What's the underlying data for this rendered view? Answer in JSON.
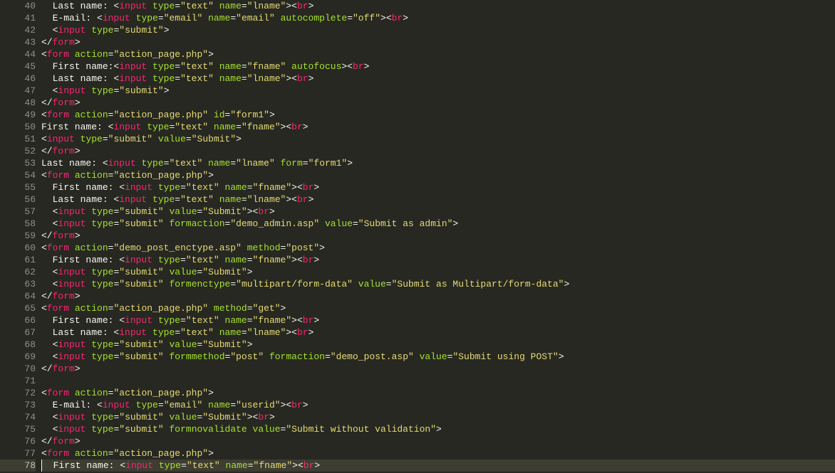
{
  "first_line_number": 40,
  "current_line_number": 78,
  "lines": [
    [
      [
        "plain",
        "  Last name: <"
      ],
      [
        "tag",
        "input"
      ],
      [
        "plain",
        " "
      ],
      [
        "attr",
        "type"
      ],
      [
        "op",
        "="
      ],
      [
        "str",
        "\"text\""
      ],
      [
        "plain",
        " "
      ],
      [
        "attr",
        "name"
      ],
      [
        "op",
        "="
      ],
      [
        "str",
        "\"lname\""
      ],
      [
        "plain",
        "><"
      ],
      [
        "tag",
        "br"
      ],
      [
        "plain",
        ">"
      ]
    ],
    [
      [
        "plain",
        "  E-mail: <"
      ],
      [
        "tag",
        "input"
      ],
      [
        "plain",
        " "
      ],
      [
        "attr",
        "type"
      ],
      [
        "op",
        "="
      ],
      [
        "str",
        "\"email\""
      ],
      [
        "plain",
        " "
      ],
      [
        "attr",
        "name"
      ],
      [
        "op",
        "="
      ],
      [
        "str",
        "\"email\""
      ],
      [
        "plain",
        " "
      ],
      [
        "attr",
        "autocomplete"
      ],
      [
        "op",
        "="
      ],
      [
        "str",
        "\"off\""
      ],
      [
        "plain",
        "><"
      ],
      [
        "tag",
        "br"
      ],
      [
        "plain",
        ">"
      ]
    ],
    [
      [
        "plain",
        "  <"
      ],
      [
        "tag",
        "input"
      ],
      [
        "plain",
        " "
      ],
      [
        "attr",
        "type"
      ],
      [
        "op",
        "="
      ],
      [
        "str",
        "\"submit\""
      ],
      [
        "plain",
        ">"
      ]
    ],
    [
      [
        "plain",
        "</"
      ],
      [
        "tag",
        "form"
      ],
      [
        "plain",
        ">"
      ]
    ],
    [
      [
        "plain",
        "<"
      ],
      [
        "tag",
        "form"
      ],
      [
        "plain",
        " "
      ],
      [
        "attr",
        "action"
      ],
      [
        "op",
        "="
      ],
      [
        "str",
        "\"action_page.php\""
      ],
      [
        "plain",
        ">"
      ]
    ],
    [
      [
        "plain",
        "  First name:<"
      ],
      [
        "tag",
        "input"
      ],
      [
        "plain",
        " "
      ],
      [
        "attr",
        "type"
      ],
      [
        "op",
        "="
      ],
      [
        "str",
        "\"text\""
      ],
      [
        "plain",
        " "
      ],
      [
        "attr",
        "name"
      ],
      [
        "op",
        "="
      ],
      [
        "str",
        "\"fname\""
      ],
      [
        "plain",
        " "
      ],
      [
        "boolattr",
        "autofocus"
      ],
      [
        "plain",
        "><"
      ],
      [
        "tag",
        "br"
      ],
      [
        "plain",
        ">"
      ]
    ],
    [
      [
        "plain",
        "  Last name: <"
      ],
      [
        "tag",
        "input"
      ],
      [
        "plain",
        " "
      ],
      [
        "attr",
        "type"
      ],
      [
        "op",
        "="
      ],
      [
        "str",
        "\"text\""
      ],
      [
        "plain",
        " "
      ],
      [
        "attr",
        "name"
      ],
      [
        "op",
        "="
      ],
      [
        "str",
        "\"lname\""
      ],
      [
        "plain",
        "><"
      ],
      [
        "tag",
        "br"
      ],
      [
        "plain",
        ">"
      ]
    ],
    [
      [
        "plain",
        "  <"
      ],
      [
        "tag",
        "input"
      ],
      [
        "plain",
        " "
      ],
      [
        "attr",
        "type"
      ],
      [
        "op",
        "="
      ],
      [
        "str",
        "\"submit\""
      ],
      [
        "plain",
        ">"
      ]
    ],
    [
      [
        "plain",
        "</"
      ],
      [
        "tag",
        "form"
      ],
      [
        "plain",
        ">"
      ]
    ],
    [
      [
        "plain",
        "<"
      ],
      [
        "tag",
        "form"
      ],
      [
        "plain",
        " "
      ],
      [
        "attr",
        "action"
      ],
      [
        "op",
        "="
      ],
      [
        "str",
        "\"action_page.php\""
      ],
      [
        "plain",
        " "
      ],
      [
        "attr",
        "id"
      ],
      [
        "op",
        "="
      ],
      [
        "str",
        "\"form1\""
      ],
      [
        "plain",
        ">"
      ]
    ],
    [
      [
        "plain",
        "First name: <"
      ],
      [
        "tag",
        "input"
      ],
      [
        "plain",
        " "
      ],
      [
        "attr",
        "type"
      ],
      [
        "op",
        "="
      ],
      [
        "str",
        "\"text\""
      ],
      [
        "plain",
        " "
      ],
      [
        "attr",
        "name"
      ],
      [
        "op",
        "="
      ],
      [
        "str",
        "\"fname\""
      ],
      [
        "plain",
        "><"
      ],
      [
        "tag",
        "br"
      ],
      [
        "plain",
        ">"
      ]
    ],
    [
      [
        "plain",
        "<"
      ],
      [
        "tag",
        "input"
      ],
      [
        "plain",
        " "
      ],
      [
        "attr",
        "type"
      ],
      [
        "op",
        "="
      ],
      [
        "str",
        "\"submit\""
      ],
      [
        "plain",
        " "
      ],
      [
        "attr",
        "value"
      ],
      [
        "op",
        "="
      ],
      [
        "str",
        "\"Submit\""
      ],
      [
        "plain",
        ">"
      ]
    ],
    [
      [
        "plain",
        "</"
      ],
      [
        "tag",
        "form"
      ],
      [
        "plain",
        ">"
      ]
    ],
    [
      [
        "plain",
        "Last name: <"
      ],
      [
        "tag",
        "input"
      ],
      [
        "plain",
        " "
      ],
      [
        "attr",
        "type"
      ],
      [
        "op",
        "="
      ],
      [
        "str",
        "\"text\""
      ],
      [
        "plain",
        " "
      ],
      [
        "attr",
        "name"
      ],
      [
        "op",
        "="
      ],
      [
        "str",
        "\"lname\""
      ],
      [
        "plain",
        " "
      ],
      [
        "attr",
        "form"
      ],
      [
        "op",
        "="
      ],
      [
        "str",
        "\"form1\""
      ],
      [
        "plain",
        ">"
      ]
    ],
    [
      [
        "plain",
        "<"
      ],
      [
        "tag",
        "form"
      ],
      [
        "plain",
        " "
      ],
      [
        "attr",
        "action"
      ],
      [
        "op",
        "="
      ],
      [
        "str",
        "\"action_page.php\""
      ],
      [
        "plain",
        ">"
      ]
    ],
    [
      [
        "plain",
        "  First name: <"
      ],
      [
        "tag",
        "input"
      ],
      [
        "plain",
        " "
      ],
      [
        "attr",
        "type"
      ],
      [
        "op",
        "="
      ],
      [
        "str",
        "\"text\""
      ],
      [
        "plain",
        " "
      ],
      [
        "attr",
        "name"
      ],
      [
        "op",
        "="
      ],
      [
        "str",
        "\"fname\""
      ],
      [
        "plain",
        "><"
      ],
      [
        "tag",
        "br"
      ],
      [
        "plain",
        ">"
      ]
    ],
    [
      [
        "plain",
        "  Last name: <"
      ],
      [
        "tag",
        "input"
      ],
      [
        "plain",
        " "
      ],
      [
        "attr",
        "type"
      ],
      [
        "op",
        "="
      ],
      [
        "str",
        "\"text\""
      ],
      [
        "plain",
        " "
      ],
      [
        "attr",
        "name"
      ],
      [
        "op",
        "="
      ],
      [
        "str",
        "\"lname\""
      ],
      [
        "plain",
        "><"
      ],
      [
        "tag",
        "br"
      ],
      [
        "plain",
        ">"
      ]
    ],
    [
      [
        "plain",
        "  <"
      ],
      [
        "tag",
        "input"
      ],
      [
        "plain",
        " "
      ],
      [
        "attr",
        "type"
      ],
      [
        "op",
        "="
      ],
      [
        "str",
        "\"submit\""
      ],
      [
        "plain",
        " "
      ],
      [
        "attr",
        "value"
      ],
      [
        "op",
        "="
      ],
      [
        "str",
        "\"Submit\""
      ],
      [
        "plain",
        "><"
      ],
      [
        "tag",
        "br"
      ],
      [
        "plain",
        ">"
      ]
    ],
    [
      [
        "plain",
        "  <"
      ],
      [
        "tag",
        "input"
      ],
      [
        "plain",
        " "
      ],
      [
        "attr",
        "type"
      ],
      [
        "op",
        "="
      ],
      [
        "str",
        "\"submit\""
      ],
      [
        "plain",
        " "
      ],
      [
        "attr",
        "formaction"
      ],
      [
        "op",
        "="
      ],
      [
        "str",
        "\"demo_admin.asp\""
      ],
      [
        "plain",
        " "
      ],
      [
        "attr",
        "value"
      ],
      [
        "op",
        "="
      ],
      [
        "str",
        "\"Submit as admin\""
      ],
      [
        "plain",
        ">"
      ]
    ],
    [
      [
        "plain",
        "</"
      ],
      [
        "tag",
        "form"
      ],
      [
        "plain",
        ">"
      ]
    ],
    [
      [
        "plain",
        "<"
      ],
      [
        "tag",
        "form"
      ],
      [
        "plain",
        " "
      ],
      [
        "attr",
        "action"
      ],
      [
        "op",
        "="
      ],
      [
        "str",
        "\"demo_post_enctype.asp\""
      ],
      [
        "plain",
        " "
      ],
      [
        "attr",
        "method"
      ],
      [
        "op",
        "="
      ],
      [
        "str",
        "\"post\""
      ],
      [
        "plain",
        ">"
      ]
    ],
    [
      [
        "plain",
        "  First name: <"
      ],
      [
        "tag",
        "input"
      ],
      [
        "plain",
        " "
      ],
      [
        "attr",
        "type"
      ],
      [
        "op",
        "="
      ],
      [
        "str",
        "\"text\""
      ],
      [
        "plain",
        " "
      ],
      [
        "attr",
        "name"
      ],
      [
        "op",
        "="
      ],
      [
        "str",
        "\"fname\""
      ],
      [
        "plain",
        "><"
      ],
      [
        "tag",
        "br"
      ],
      [
        "plain",
        ">"
      ]
    ],
    [
      [
        "plain",
        "  <"
      ],
      [
        "tag",
        "input"
      ],
      [
        "plain",
        " "
      ],
      [
        "attr",
        "type"
      ],
      [
        "op",
        "="
      ],
      [
        "str",
        "\"submit\""
      ],
      [
        "plain",
        " "
      ],
      [
        "attr",
        "value"
      ],
      [
        "op",
        "="
      ],
      [
        "str",
        "\"Submit\""
      ],
      [
        "plain",
        ">"
      ]
    ],
    [
      [
        "plain",
        "  <"
      ],
      [
        "tag",
        "input"
      ],
      [
        "plain",
        " "
      ],
      [
        "attr",
        "type"
      ],
      [
        "op",
        "="
      ],
      [
        "str",
        "\"submit\""
      ],
      [
        "plain",
        " "
      ],
      [
        "attr",
        "formenctype"
      ],
      [
        "op",
        "="
      ],
      [
        "str",
        "\"multipart/form-data\""
      ],
      [
        "plain",
        " "
      ],
      [
        "attr",
        "value"
      ],
      [
        "op",
        "="
      ],
      [
        "str",
        "\"Submit as Multipart/form-data\""
      ],
      [
        "plain",
        ">"
      ]
    ],
    [
      [
        "plain",
        "</"
      ],
      [
        "tag",
        "form"
      ],
      [
        "plain",
        ">"
      ]
    ],
    [
      [
        "plain",
        "<"
      ],
      [
        "tag",
        "form"
      ],
      [
        "plain",
        " "
      ],
      [
        "attr",
        "action"
      ],
      [
        "op",
        "="
      ],
      [
        "str",
        "\"action_page.php\""
      ],
      [
        "plain",
        " "
      ],
      [
        "attr",
        "method"
      ],
      [
        "op",
        "="
      ],
      [
        "str",
        "\"get\""
      ],
      [
        "plain",
        ">"
      ]
    ],
    [
      [
        "plain",
        "  First name: <"
      ],
      [
        "tag",
        "input"
      ],
      [
        "plain",
        " "
      ],
      [
        "attr",
        "type"
      ],
      [
        "op",
        "="
      ],
      [
        "str",
        "\"text\""
      ],
      [
        "plain",
        " "
      ],
      [
        "attr",
        "name"
      ],
      [
        "op",
        "="
      ],
      [
        "str",
        "\"fname\""
      ],
      [
        "plain",
        "><"
      ],
      [
        "tag",
        "br"
      ],
      [
        "plain",
        ">"
      ]
    ],
    [
      [
        "plain",
        "  Last name: <"
      ],
      [
        "tag",
        "input"
      ],
      [
        "plain",
        " "
      ],
      [
        "attr",
        "type"
      ],
      [
        "op",
        "="
      ],
      [
        "str",
        "\"text\""
      ],
      [
        "plain",
        " "
      ],
      [
        "attr",
        "name"
      ],
      [
        "op",
        "="
      ],
      [
        "str",
        "\"lname\""
      ],
      [
        "plain",
        "><"
      ],
      [
        "tag",
        "br"
      ],
      [
        "plain",
        ">"
      ]
    ],
    [
      [
        "plain",
        "  <"
      ],
      [
        "tag",
        "input"
      ],
      [
        "plain",
        " "
      ],
      [
        "attr",
        "type"
      ],
      [
        "op",
        "="
      ],
      [
        "str",
        "\"submit\""
      ],
      [
        "plain",
        " "
      ],
      [
        "attr",
        "value"
      ],
      [
        "op",
        "="
      ],
      [
        "str",
        "\"Submit\""
      ],
      [
        "plain",
        ">"
      ]
    ],
    [
      [
        "plain",
        "  <"
      ],
      [
        "tag",
        "input"
      ],
      [
        "plain",
        " "
      ],
      [
        "attr",
        "type"
      ],
      [
        "op",
        "="
      ],
      [
        "str",
        "\"submit\""
      ],
      [
        "plain",
        " "
      ],
      [
        "attr",
        "formmethod"
      ],
      [
        "op",
        "="
      ],
      [
        "str",
        "\"post\""
      ],
      [
        "plain",
        " "
      ],
      [
        "attr",
        "formaction"
      ],
      [
        "op",
        "="
      ],
      [
        "str",
        "\"demo_post.asp\""
      ],
      [
        "plain",
        " "
      ],
      [
        "attr",
        "value"
      ],
      [
        "op",
        "="
      ],
      [
        "str",
        "\"Submit using POST\""
      ],
      [
        "plain",
        ">"
      ]
    ],
    [
      [
        "plain",
        "</"
      ],
      [
        "tag",
        "form"
      ],
      [
        "plain",
        ">"
      ]
    ],
    [],
    [
      [
        "plain",
        "<"
      ],
      [
        "tag",
        "form"
      ],
      [
        "plain",
        " "
      ],
      [
        "attr",
        "action"
      ],
      [
        "op",
        "="
      ],
      [
        "str",
        "\"action_page.php\""
      ],
      [
        "plain",
        ">"
      ]
    ],
    [
      [
        "plain",
        "  E-mail: <"
      ],
      [
        "tag",
        "input"
      ],
      [
        "plain",
        " "
      ],
      [
        "attr",
        "type"
      ],
      [
        "op",
        "="
      ],
      [
        "str",
        "\"email\""
      ],
      [
        "plain",
        " "
      ],
      [
        "attr",
        "name"
      ],
      [
        "op",
        "="
      ],
      [
        "str",
        "\"userid\""
      ],
      [
        "plain",
        "><"
      ],
      [
        "tag",
        "br"
      ],
      [
        "plain",
        ">"
      ]
    ],
    [
      [
        "plain",
        "  <"
      ],
      [
        "tag",
        "input"
      ],
      [
        "plain",
        " "
      ],
      [
        "attr",
        "type"
      ],
      [
        "op",
        "="
      ],
      [
        "str",
        "\"submit\""
      ],
      [
        "plain",
        " "
      ],
      [
        "attr",
        "value"
      ],
      [
        "op",
        "="
      ],
      [
        "str",
        "\"Submit\""
      ],
      [
        "plain",
        "><"
      ],
      [
        "tag",
        "br"
      ],
      [
        "plain",
        ">"
      ]
    ],
    [
      [
        "plain",
        "  <"
      ],
      [
        "tag",
        "input"
      ],
      [
        "plain",
        " "
      ],
      [
        "attr",
        "type"
      ],
      [
        "op",
        "="
      ],
      [
        "str",
        "\"submit\""
      ],
      [
        "plain",
        " "
      ],
      [
        "boolattr",
        "formnovalidate"
      ],
      [
        "plain",
        " "
      ],
      [
        "attr",
        "value"
      ],
      [
        "op",
        "="
      ],
      [
        "str",
        "\"Submit without validation\""
      ],
      [
        "plain",
        ">"
      ]
    ],
    [
      [
        "plain",
        "</"
      ],
      [
        "tag",
        "form"
      ],
      [
        "plain",
        ">"
      ]
    ],
    [
      [
        "plain",
        "<"
      ],
      [
        "tag",
        "form"
      ],
      [
        "plain",
        " "
      ],
      [
        "attr",
        "action"
      ],
      [
        "op",
        "="
      ],
      [
        "str",
        "\"action_page.php\""
      ],
      [
        "plain",
        ">"
      ]
    ],
    [
      [
        "plain",
        "  First name: <"
      ],
      [
        "tag",
        "input"
      ],
      [
        "plain",
        " "
      ],
      [
        "attr",
        "type"
      ],
      [
        "op",
        "="
      ],
      [
        "str",
        "\"text\""
      ],
      [
        "plain",
        " "
      ],
      [
        "attr",
        "name"
      ],
      [
        "op",
        "="
      ],
      [
        "str",
        "\"fname\""
      ],
      [
        "plain",
        "><"
      ],
      [
        "tag",
        "br"
      ],
      [
        "plain",
        ">"
      ]
    ]
  ]
}
